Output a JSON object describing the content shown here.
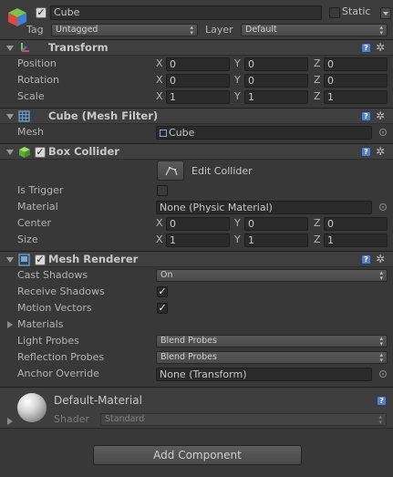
{
  "gameobject": {
    "name": "Cube",
    "static_label": "Static",
    "tag_label": "Tag",
    "tag_value": "Untagged",
    "layer_label": "Layer",
    "layer_value": "Default"
  },
  "transform": {
    "title": "Transform",
    "position_label": "Position",
    "rotation_label": "Rotation",
    "scale_label": "Scale",
    "position": {
      "x": "0",
      "y": "0",
      "z": "0"
    },
    "rotation": {
      "x": "0",
      "y": "0",
      "z": "0"
    },
    "scale": {
      "x": "1",
      "y": "1",
      "z": "1"
    }
  },
  "axes": {
    "x": "X",
    "y": "Y",
    "z": "Z"
  },
  "mesh_filter": {
    "title": "Cube (Mesh Filter)",
    "mesh_label": "Mesh",
    "mesh_value": "Cube"
  },
  "box_collider": {
    "title": "Box Collider",
    "edit_collider_label": "Edit Collider",
    "is_trigger_label": "Is Trigger",
    "material_label": "Material",
    "material_value": "None (Physic Material)",
    "center_label": "Center",
    "size_label": "Size",
    "center": {
      "x": "0",
      "y": "0",
      "z": "0"
    },
    "size": {
      "x": "1",
      "y": "1",
      "z": "1"
    }
  },
  "mesh_renderer": {
    "title": "Mesh Renderer",
    "cast_shadows_label": "Cast Shadows",
    "cast_shadows_value": "On",
    "receive_shadows_label": "Receive Shadows",
    "motion_vectors_label": "Motion Vectors",
    "materials_label": "Materials",
    "light_probes_label": "Light Probes",
    "light_probes_value": "Blend Probes",
    "reflection_probes_label": "Reflection Probes",
    "reflection_probes_value": "Blend Probes",
    "anchor_override_label": "Anchor Override",
    "anchor_override_value": "None (Transform)"
  },
  "material": {
    "name": "Default-Material",
    "shader_label": "Shader",
    "shader_value": "Standard"
  },
  "add_component_label": "Add Component",
  "icons": {
    "help": "?",
    "gear": "✲",
    "check": "✓",
    "arrow": "▴▾"
  }
}
